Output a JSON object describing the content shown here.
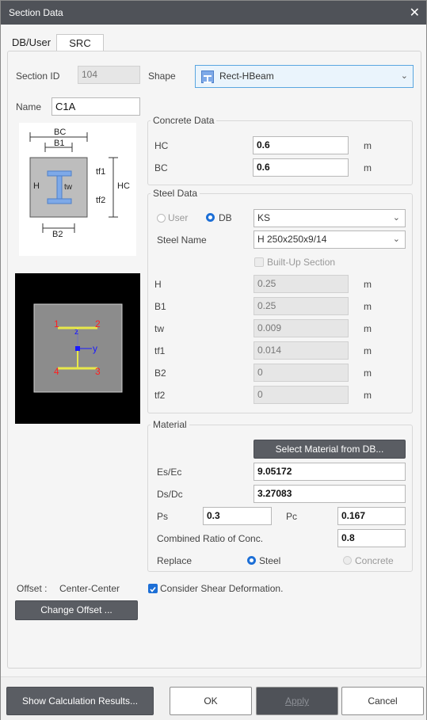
{
  "window": {
    "title": "Section Data",
    "close_glyph": "✕"
  },
  "tabs": [
    {
      "label": "DB/User"
    },
    {
      "label": "SRC"
    }
  ],
  "section": {
    "id_label": "Section ID",
    "id_value": "104",
    "shape_label": "Shape",
    "shape_value": "Rect-HBeam",
    "name_label": "Name",
    "name_value": "C1A"
  },
  "diagram": {
    "bc": "BC",
    "b1": "B1",
    "b2": "B2",
    "h": "H",
    "hc": "HC",
    "tw": "tw",
    "tf1": "tf1",
    "tf2": "tf2"
  },
  "preview": {
    "p1": "1",
    "p2": "2",
    "p3": "3",
    "p4": "4",
    "z": "z",
    "y": "y"
  },
  "concrete": {
    "title": "Concrete Data",
    "hc_label": "HC",
    "hc_value": "0.6",
    "bc_label": "BC",
    "bc_value": "0.6",
    "unit": "m"
  },
  "steel": {
    "title": "Steel Data",
    "user_label": "User",
    "db_label": "DB",
    "db_value": "KS",
    "name_label": "Steel Name",
    "name_value": "H 250x250x9/14",
    "builtup_label": "Built-Up Section",
    "unit": "m",
    "rows": [
      {
        "label": "H",
        "value": "0.25"
      },
      {
        "label": "B1",
        "value": "0.25"
      },
      {
        "label": "tw",
        "value": "0.009"
      },
      {
        "label": "tf1",
        "value": "0.014"
      },
      {
        "label": "B2",
        "value": "0"
      },
      {
        "label": "tf2",
        "value": "0"
      }
    ]
  },
  "material": {
    "title": "Material",
    "select_button": "Select Material from DB...",
    "es_label": "Es/Ec",
    "es_value": "9.05172",
    "ds_label": "Ds/Dc",
    "ds_value": "3.27083",
    "ps_label": "Ps",
    "ps_value": "0.3",
    "pc_label": "Pc",
    "pc_value": "0.167",
    "ratio_label": "Combined Ratio of Conc.",
    "ratio_value": "0.8",
    "replace_label": "Replace",
    "steel_label": "Steel",
    "concrete_label": "Concrete"
  },
  "offset": {
    "label": "Offset :",
    "value": "Center-Center",
    "change_button": "Change Offset ..."
  },
  "shear": {
    "label": "Consider Shear Deformation."
  },
  "footer": {
    "show_button": "Show Calculation Results...",
    "ok_button": "OK",
    "apply_button": "Apply",
    "cancel_button": "Cancel"
  },
  "colors": {
    "titlebar": "#4f5258",
    "accent": "#1d6fd6",
    "beam_fill": "#7ea9e8",
    "preview_bg": "#000000",
    "section_fill": "#8c8c8c",
    "flange": "#e8e84a",
    "point_label": "#ff2020"
  }
}
